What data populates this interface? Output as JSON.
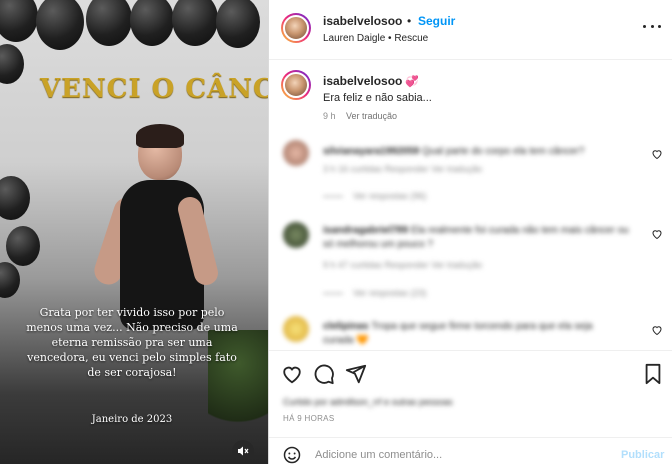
{
  "post": {
    "banner_text": "VENCI O CÂNCI",
    "overlay_quote": "Grata por ter vivido isso por pelo menos uma vez... Não preciso de uma eterna remissão pra ser uma vencedora, eu venci pelo simples fato de ser corajosa!",
    "overlay_date": "Janeiro de 2023"
  },
  "header": {
    "username": "isabelvelosoo",
    "dot": "•",
    "follow_label": "Seguir",
    "subtitle": "Lauren Daigle • Rescue"
  },
  "caption": {
    "username": "isabelvelosoo",
    "emoji": "💞",
    "text": "Era feliz e não sabia...",
    "time": "9 h",
    "translate_label": "Ver tradução"
  },
  "comments": [
    {
      "username": "silvianayara1992059",
      "text": "Qual parte do corpo ela tem câncer?",
      "meta": "3 h  16 curtidas  Responder  Ver tradução",
      "replies": "Ver respostas (96)"
    },
    {
      "username": "isandragabriel789",
      "text": "Ela realmente foi curada não tem mais câncer ou só melhorou um pouco ?",
      "meta": "9 h  47 curtidas  Responder  Ver tradução",
      "replies": "Ver respostas (23)"
    },
    {
      "username": "clelipinas",
      "text": "Tropa que segue firme torcendo para que ela seja curada 🧡",
      "meta": "",
      "replies": ""
    }
  ],
  "footer": {
    "liked_by": "Curtido por admillson_rrf e outras pessoas",
    "ago": "HÁ 9 HORAS",
    "comment_placeholder": "Adicione um comentário...",
    "publish_label": "Publicar"
  },
  "colors": {
    "accent": "#0095f6",
    "banner_gold": "#c9a227"
  }
}
